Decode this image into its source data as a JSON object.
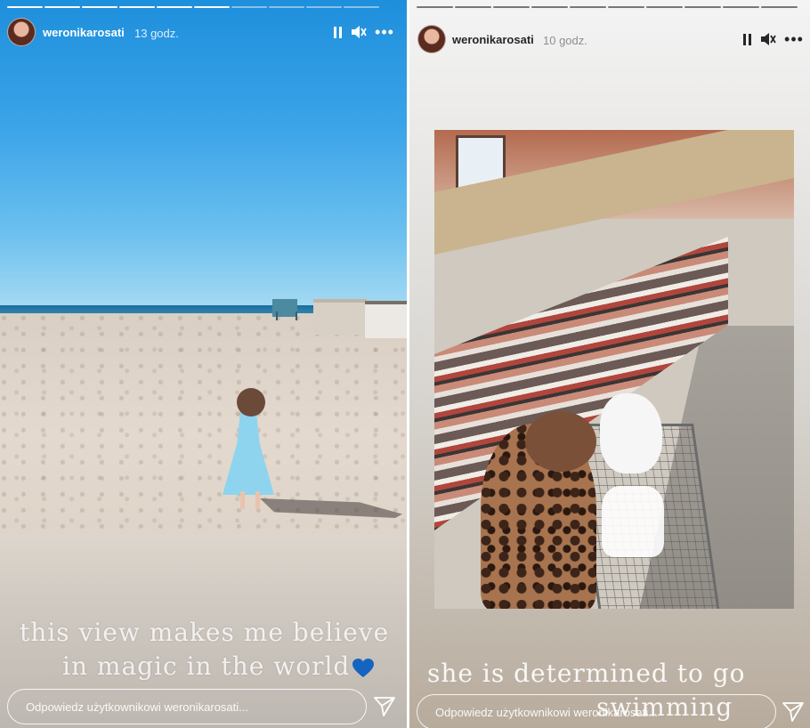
{
  "stories": [
    {
      "username": "weronikarosati",
      "time": "13 godz.",
      "caption_line1": "this view makes me believe",
      "caption_line2": "in magic in the world",
      "reply_placeholder": "Odpowiedz użytkownikowi weronikarosati...",
      "icons": {
        "pause": "pause-icon",
        "sound": "mute-icon",
        "more": "more-icon",
        "send": "send-icon",
        "heart": "blue-heart-emoji"
      }
    },
    {
      "username": "weronikarosati",
      "time": "10 godz.",
      "caption_line1": "she is determined to go",
      "caption_line2": "swimming",
      "reply_placeholder": "Odpowiedz użytkownikowi weronikarosati...",
      "icons": {
        "pause": "pause-icon",
        "sound": "mute-icon",
        "more": "more-icon",
        "send": "send-icon"
      }
    }
  ],
  "more_glyph": "•••",
  "colors": {
    "heart": "#1565c0",
    "text_light": "#ffffff",
    "text_dark": "#262626"
  }
}
